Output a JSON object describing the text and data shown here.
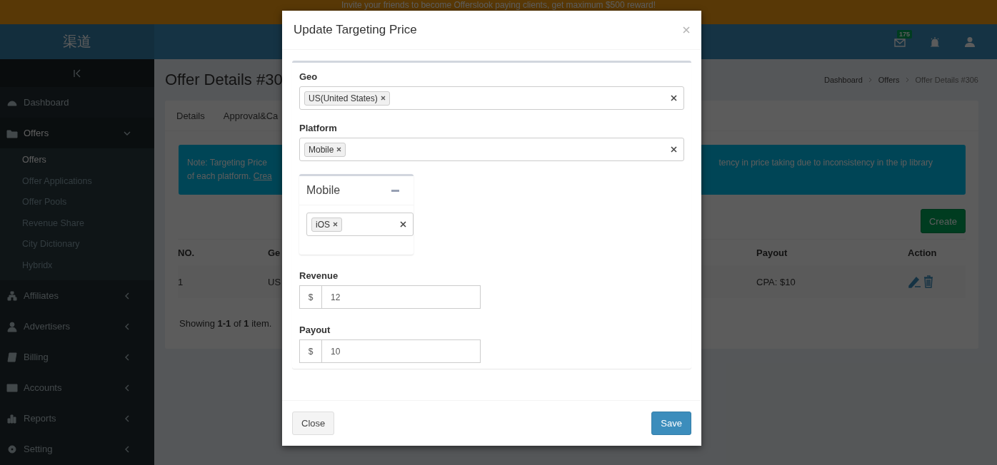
{
  "banner": {
    "text": "Invite your friends to become Offerslook paying clients, get maximum $500 reward!"
  },
  "sidebar": {
    "logo": "渠道",
    "items": [
      {
        "label": "Dashboard"
      },
      {
        "label": "Offers",
        "expanded": true,
        "children": [
          {
            "label": "Offers",
            "selected": true
          },
          {
            "label": "Offer Applications",
            "selected": false
          },
          {
            "label": "Offer Pools",
            "selected": false
          },
          {
            "label": "Revenue Share",
            "selected": false
          },
          {
            "label": "City Dictionary",
            "selected": false
          },
          {
            "label": "Hybridx",
            "selected": false
          }
        ]
      },
      {
        "label": "Affiliates",
        "expanded": false
      },
      {
        "label": "Advertisers",
        "expanded": false
      },
      {
        "label": "Billing",
        "expanded": false
      },
      {
        "label": "Accounts",
        "expanded": false
      },
      {
        "label": "Reports",
        "expanded": false
      },
      {
        "label": "Setting",
        "expanded": false
      }
    ]
  },
  "header": {
    "mail_badge": "175"
  },
  "page": {
    "title": "Offer Details #30",
    "breadcrumb": [
      "Dashboard",
      "Offers",
      "Offer Details #306"
    ],
    "tabs": [
      "Details",
      "Approval&Ca"
    ],
    "note": {
      "left": "Note: Targeting Price",
      "left_2": "of each platform.",
      "link": "Crea",
      "right": "tency in price taking due to inconsistency in the ip library"
    },
    "create_button": "Create",
    "table": {
      "columns": [
        "NO.",
        "Ge",
        "Payout",
        "Action"
      ],
      "rows": [
        [
          "1",
          "US",
          "CPA: $10"
        ]
      ]
    },
    "footer": "Showing **1-1** of **1** item."
  },
  "modal": {
    "title": "Update Targeting Price",
    "geo": {
      "label": "Geo",
      "tags": [
        "US(United States)"
      ]
    },
    "platform": {
      "label": "Platform",
      "tags": [
        "Mobile"
      ]
    },
    "platform_panels": [
      {
        "title": "Mobile",
        "expanded": true,
        "tags": [
          "iOS"
        ]
      }
    ],
    "revenue": {
      "label": "Revenue",
      "addon": "$",
      "value": "12"
    },
    "payout": {
      "label": "Payout",
      "addon": "$",
      "value": "10"
    },
    "buttons": {
      "close": "Close",
      "save": "Save"
    }
  }
}
